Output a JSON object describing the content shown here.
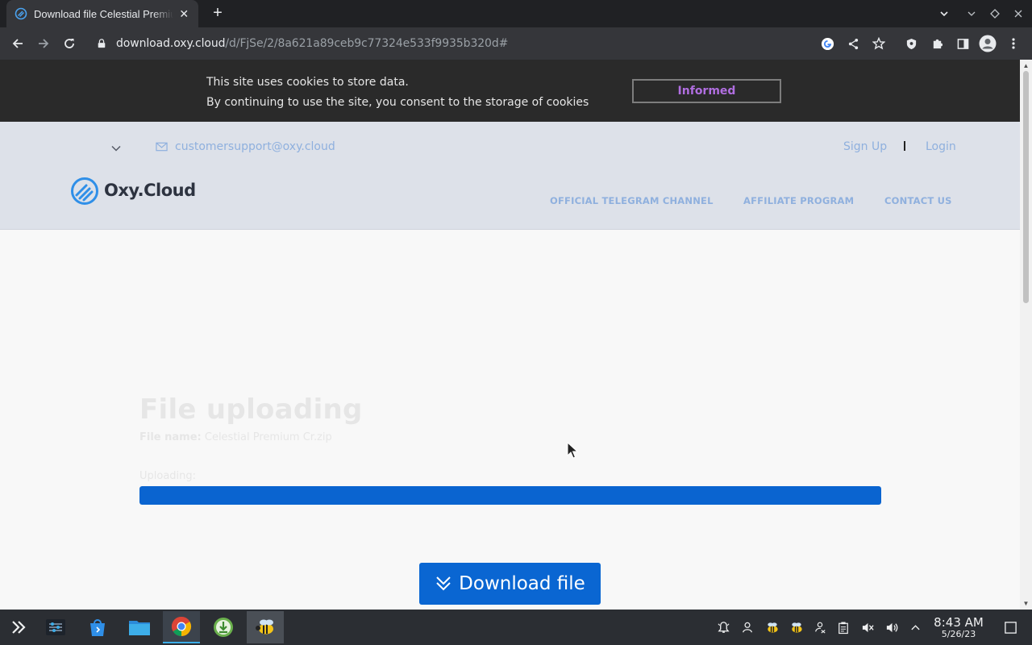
{
  "browser": {
    "tab_title": "Download file Celestial Premium Cr.zip",
    "tab_close": "✕",
    "new_tab": "+",
    "url_host": "download.oxy.cloud",
    "url_path": "/d/FjSe/2/8a621a89ceb9c77324e533f9935b320d#"
  },
  "cookie_banner": {
    "line1": "This site uses cookies to store data.",
    "line2": "By continuing to use the site, you consent to the storage of cookies",
    "button": "Informed"
  },
  "site_header": {
    "email": "customersupport@oxy.cloud",
    "signup": "Sign Up",
    "login": "Login",
    "logo_text": "Oxy.Cloud",
    "nav": [
      "OFFICIAL TELEGRAM CHANNEL",
      "AFFILIATE PROGRAM",
      "CONTACT US"
    ]
  },
  "upload": {
    "heading": "File uploading",
    "file_name_label": "File name:",
    "file_name": "Celestial Premium Cr.zip",
    "uploading_label": "Uploading:",
    "progress_percent": 100,
    "download_button": "Download file"
  },
  "taskbar": {
    "time": "8:43 AM",
    "date": "5/26/23"
  },
  "colors": {
    "accent": "#0a66d2",
    "cookie_button_text": "#b06ee0",
    "header_bg": "#dde1e9",
    "header_link": "#8fb0de"
  }
}
